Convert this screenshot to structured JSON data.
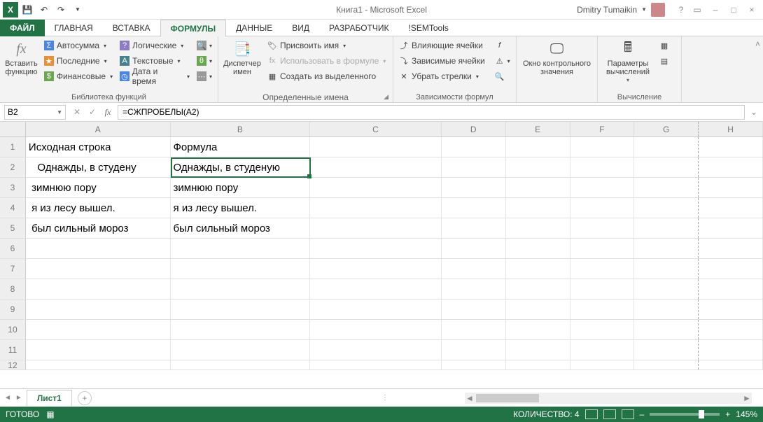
{
  "title": "Книга1 - Microsoft Excel",
  "user": "Dmitry Tumaikin",
  "tabs": {
    "file": "ФАЙЛ",
    "home": "ГЛАВНАЯ",
    "insert": "ВСТАВКА",
    "formulas": "ФОРМУЛЫ",
    "data": "ДАННЫЕ",
    "view": "ВИД",
    "developer": "РАЗРАБОТЧИК",
    "semtools": "!SEMTools"
  },
  "ribbon": {
    "insertfn": "Вставить функцию",
    "lib": {
      "autosum": "Автосумма",
      "recent": "Последние",
      "financial": "Финансовые",
      "logical": "Логические",
      "text": "Текстовые",
      "datetime": "Дата и время",
      "label": "Библиотека функций"
    },
    "names": {
      "manager": "Диспетчер имен",
      "assign": "Присвоить имя",
      "useinf": "Использовать в формуле",
      "createsel": "Создать из выделенного",
      "label": "Определенные имена"
    },
    "deps": {
      "precedents": "Влияющие ячейки",
      "dependents": "Зависимые ячейки",
      "removearrows": "Убрать стрелки",
      "label": "Зависимости формул"
    },
    "watch": {
      "btn": "Окно контрольного значения"
    },
    "calc": {
      "btn": "Параметры вычислений",
      "label": "Вычисление"
    }
  },
  "name_box": "B2",
  "formula": "=СЖПРОБЕЛЫ(A2)",
  "cols": [
    "A",
    "B",
    "C",
    "D",
    "E",
    "F",
    "G",
    "H"
  ],
  "rows": [
    "1",
    "2",
    "3",
    "4",
    "5",
    "6",
    "7",
    "8",
    "9",
    "10",
    "11",
    "12"
  ],
  "cells": {
    "A1": "Исходная строка",
    "B1": "Формула",
    "A2": "   Однажды, в студену",
    "B2": "Однажды, в студеную",
    "A3": " зимнюю пору",
    "B3": "зимнюю пору",
    "A4": " я из лесу вышел.",
    "B4": "я из лесу вышел.",
    "A5": " был сильный мороз",
    "B5": "был сильный мороз"
  },
  "sheet_tab": "Лист1",
  "status": {
    "ready": "ГОТОВО",
    "count_lbl": "КОЛИЧЕСТВО:",
    "count": "4",
    "zoom": "145%"
  }
}
